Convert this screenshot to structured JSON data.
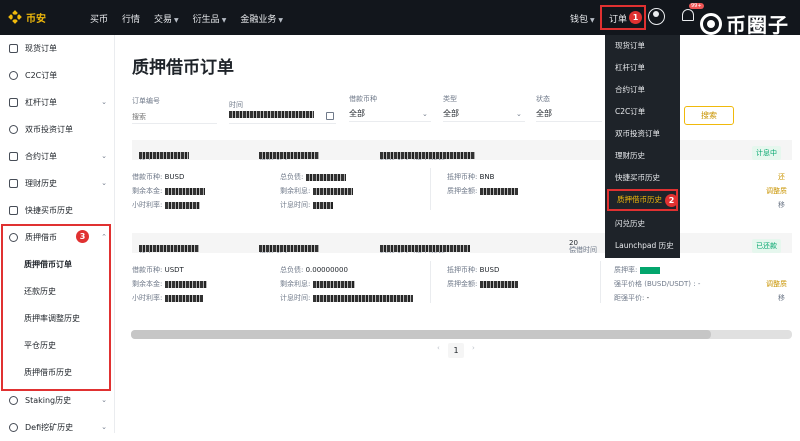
{
  "topbar": {
    "logo_text": "币安",
    "nav": [
      "买币",
      "行情",
      "交易",
      "衍生品",
      "金融业务"
    ],
    "wallet": "钱包",
    "orders": "订单",
    "bell_badge": "99+"
  },
  "watermark": {
    "text": "币圈子"
  },
  "badges": {
    "one": "1",
    "two": "2",
    "three": "3"
  },
  "sidebar": {
    "items": [
      {
        "label": "现货订单"
      },
      {
        "label": "C2C订单"
      },
      {
        "label": "杠杆订单"
      },
      {
        "label": "双币投资订单"
      },
      {
        "label": "合约订单"
      },
      {
        "label": "理财历史"
      },
      {
        "label": "快捷买币历史"
      },
      {
        "label": "质押借币"
      },
      {
        "label": "Staking历史"
      },
      {
        "label": "Defi挖矿历史"
      }
    ],
    "pledge_sub": [
      "质押借币订单",
      "还款历史",
      "质押率调整历史",
      "平仓历史",
      "质押借币历史"
    ]
  },
  "main": {
    "title": "质押借币订单",
    "filters": {
      "order_no_label": "订单编号",
      "order_no_placeholder": "搜索",
      "time_label": "时间",
      "borrow_coin_label": "借款币种",
      "borrow_coin_value": "全部",
      "type_label": "类型",
      "type_value": "全部",
      "status_label": "状态",
      "status_value": "全部",
      "search_button": "搜索"
    },
    "card1": {
      "order_id_label": "订单ID",
      "borrow_time_label": "借款时间",
      "expire_label": "到期时间（借币期限）",
      "status": "计息中",
      "borrow_coin_label": "借款币种:",
      "borrow_coin": "BUSD",
      "total_debt_label": "总负债:",
      "collateral_label": "抵押币种:",
      "collateral": "BNB",
      "principal_label": "剩余本金:",
      "interest_left_label": "剩余利息:",
      "pledge_amount_label": "质押金额:",
      "hourly_label": "小时利率:",
      "interest_time_label": "计息时间:",
      "action1": "还",
      "action2": "调整质",
      "action3": "移"
    },
    "card2": {
      "order_id_label": "订单ID",
      "borrow_time_label": "借款时间",
      "expire_label": "到期时间（借币期限）",
      "repay_time_label": "偿借时间",
      "repay_time_value": "20",
      "status": "已还款",
      "borrow_coin_label": "借款币种:",
      "borrow_coin": "USDT",
      "total_debt_label": "总负债:",
      "total_debt": "0.00000000",
      "collateral_label": "抵押币种:",
      "collateral": "BUSD",
      "principal_label": "剩余本金:",
      "interest_left_label": "剩余利息:",
      "pledge_amount_label": "质押金额:",
      "hourly_label": "小时利率:",
      "interest_time_label": "计息时间:",
      "pledge_rate_label": "质押率:",
      "liq_price_label": "强平价格 (BUSD/USDT) : -",
      "distance_label": "距强平价:",
      "distance_value": "-",
      "action1": "调整质",
      "action2": "移"
    },
    "pager": {
      "prev": "‹",
      "page": "1",
      "next": "›"
    }
  },
  "dropdown": {
    "items": [
      "现货订单",
      "杠杆订单",
      "合约订单",
      "C2C订单",
      "双币投资订单",
      "理财历史",
      "快捷买币历史",
      "质押借币历史",
      "闪兑历史",
      "Launchpad 历史"
    ]
  }
}
